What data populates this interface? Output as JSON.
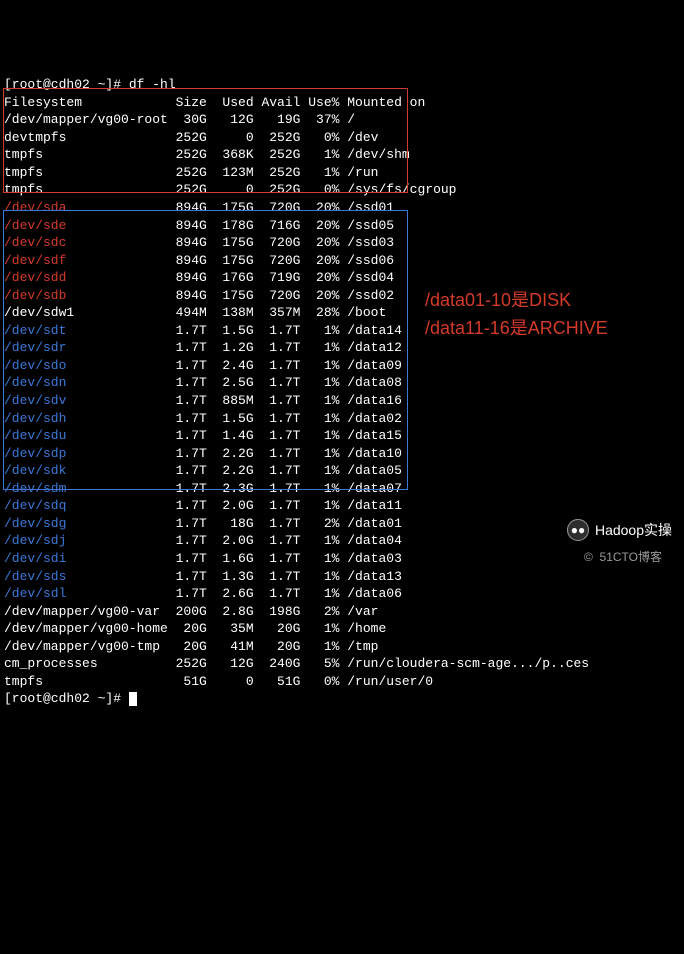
{
  "prompt_host": "[root@cdh02 ~]# ",
  "command": "df -hl",
  "header": {
    "fs": "Filesystem",
    "size": "Size",
    "used": "Used",
    "avail": "Avail",
    "usep": "Use%",
    "mount": "Mounted on"
  },
  "pre_rows": [
    {
      "fs": "/dev/mapper/vg00-root",
      "size": "30G",
      "used": "12G",
      "avail": "19G",
      "usep": "37%",
      "mount": "/"
    },
    {
      "fs": "devtmpfs",
      "size": "252G",
      "used": "0",
      "avail": "252G",
      "usep": "0%",
      "mount": "/dev"
    },
    {
      "fs": "tmpfs",
      "size": "252G",
      "used": "368K",
      "avail": "252G",
      "usep": "1%",
      "mount": "/dev/shm"
    },
    {
      "fs": "tmpfs",
      "size": "252G",
      "used": "123M",
      "avail": "252G",
      "usep": "1%",
      "mount": "/run"
    },
    {
      "fs": "tmpfs",
      "size": "252G",
      "used": "0",
      "avail": "252G",
      "usep": "0%",
      "mount": "/sys/fs/cgroup"
    }
  ],
  "red_rows": [
    {
      "fs": "/dev/sda",
      "size": "894G",
      "used": "175G",
      "avail": "720G",
      "usep": "20%",
      "mount": "/ssd01"
    },
    {
      "fs": "/dev/sde",
      "size": "894G",
      "used": "178G",
      "avail": "716G",
      "usep": "20%",
      "mount": "/ssd05"
    },
    {
      "fs": "/dev/sdc",
      "size": "894G",
      "used": "175G",
      "avail": "720G",
      "usep": "20%",
      "mount": "/ssd03"
    },
    {
      "fs": "/dev/sdf",
      "size": "894G",
      "used": "175G",
      "avail": "720G",
      "usep": "20%",
      "mount": "/ssd06"
    },
    {
      "fs": "/dev/sdd",
      "size": "894G",
      "used": "176G",
      "avail": "719G",
      "usep": "20%",
      "mount": "/ssd04"
    },
    {
      "fs": "/dev/sdb",
      "size": "894G",
      "used": "175G",
      "avail": "720G",
      "usep": "20%",
      "mount": "/ssd02"
    }
  ],
  "boot_row": {
    "fs": "/dev/sdw1",
    "size": "494M",
    "used": "138M",
    "avail": "357M",
    "usep": "28%",
    "mount": "/boot"
  },
  "blue_rows": [
    {
      "fs": "/dev/sdt",
      "size": "1.7T",
      "used": "1.5G",
      "avail": "1.7T",
      "usep": "1%",
      "mount": "/data14"
    },
    {
      "fs": "/dev/sdr",
      "size": "1.7T",
      "used": "1.2G",
      "avail": "1.7T",
      "usep": "1%",
      "mount": "/data12"
    },
    {
      "fs": "/dev/sdo",
      "size": "1.7T",
      "used": "2.4G",
      "avail": "1.7T",
      "usep": "1%",
      "mount": "/data09"
    },
    {
      "fs": "/dev/sdn",
      "size": "1.7T",
      "used": "2.5G",
      "avail": "1.7T",
      "usep": "1%",
      "mount": "/data08"
    },
    {
      "fs": "/dev/sdv",
      "size": "1.7T",
      "used": "885M",
      "avail": "1.7T",
      "usep": "1%",
      "mount": "/data16"
    },
    {
      "fs": "/dev/sdh",
      "size": "1.7T",
      "used": "1.5G",
      "avail": "1.7T",
      "usep": "1%",
      "mount": "/data02"
    },
    {
      "fs": "/dev/sdu",
      "size": "1.7T",
      "used": "1.4G",
      "avail": "1.7T",
      "usep": "1%",
      "mount": "/data15"
    },
    {
      "fs": "/dev/sdp",
      "size": "1.7T",
      "used": "2.2G",
      "avail": "1.7T",
      "usep": "1%",
      "mount": "/data10"
    },
    {
      "fs": "/dev/sdk",
      "size": "1.7T",
      "used": "2.2G",
      "avail": "1.7T",
      "usep": "1%",
      "mount": "/data05"
    },
    {
      "fs": "/dev/sdm",
      "size": "1.7T",
      "used": "2.3G",
      "avail": "1.7T",
      "usep": "1%",
      "mount": "/data07"
    },
    {
      "fs": "/dev/sdq",
      "size": "1.7T",
      "used": "2.0G",
      "avail": "1.7T",
      "usep": "1%",
      "mount": "/data11"
    },
    {
      "fs": "/dev/sdg",
      "size": "1.7T",
      "used": "18G",
      "avail": "1.7T",
      "usep": "2%",
      "mount": "/data01"
    },
    {
      "fs": "/dev/sdj",
      "size": "1.7T",
      "used": "2.0G",
      "avail": "1.7T",
      "usep": "1%",
      "mount": "/data04"
    },
    {
      "fs": "/dev/sdi",
      "size": "1.7T",
      "used": "1.6G",
      "avail": "1.7T",
      "usep": "1%",
      "mount": "/data03"
    },
    {
      "fs": "/dev/sds",
      "size": "1.7T",
      "used": "1.3G",
      "avail": "1.7T",
      "usep": "1%",
      "mount": "/data13"
    },
    {
      "fs": "/dev/sdl",
      "size": "1.7T",
      "used": "2.6G",
      "avail": "1.7T",
      "usep": "1%",
      "mount": "/data06"
    }
  ],
  "post_rows": [
    {
      "fs": "/dev/mapper/vg00-var",
      "size": "200G",
      "used": "2.8G",
      "avail": "198G",
      "usep": "2%",
      "mount": "/var"
    },
    {
      "fs": "/dev/mapper/vg00-home",
      "size": "20G",
      "used": "35M",
      "avail": "20G",
      "usep": "1%",
      "mount": "/home"
    },
    {
      "fs": "/dev/mapper/vg00-tmp",
      "size": "20G",
      "used": "41M",
      "avail": "20G",
      "usep": "1%",
      "mount": "/tmp"
    },
    {
      "fs": "cm_processes",
      "size": "252G",
      "used": "12G",
      "avail": "240G",
      "usep": "5%",
      "mount": "/run/cloudera-scm-age.../p..ces"
    },
    {
      "fs": "tmpfs",
      "size": "51G",
      "used": "0",
      "avail": "51G",
      "usep": "0%",
      "mount": "/run/user/0"
    }
  ],
  "annot1": "/data01-10是DISK",
  "annot2": "/data11-16是ARCHIVE",
  "wm1": "Hadoop实操",
  "wm2": "©  51CTO博客"
}
